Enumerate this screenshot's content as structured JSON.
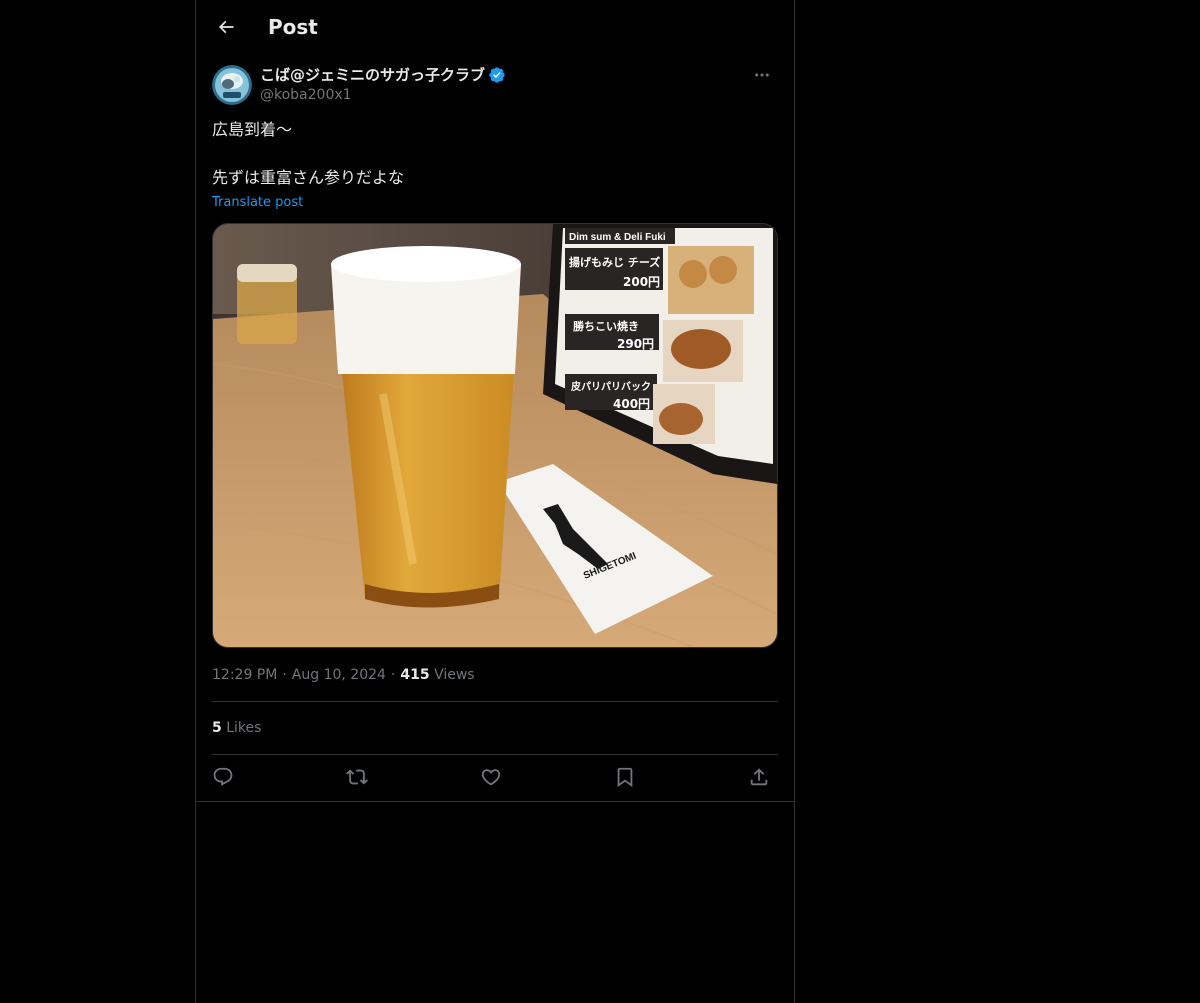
{
  "header": {
    "title": "Post",
    "back_icon": "arrow-left-icon"
  },
  "author": {
    "display_name": "こば@ジェミニのサガっ子クラブ",
    "handle": "@koba200x1",
    "verified_color": "#1d9bf0"
  },
  "post": {
    "line1": "広島到着〜",
    "line2": "先ずは重富さん参りだよな",
    "translate_label": "Translate post",
    "media_texts": {
      "menu_header": "Dim sum & Deli Fuki",
      "item1": "揚げもみじ チーズ",
      "item1_price": "200円",
      "item2": "勝ちこい焼き",
      "item2_price": "290円",
      "item3": "皮パリパリバック",
      "item3_price": "400円",
      "napkin_brand": "SHIGETOMI"
    }
  },
  "meta": {
    "time": "12:29 PM",
    "date": "Aug 10, 2024",
    "views_count": "415",
    "views_label": "Views",
    "separator": "·"
  },
  "engagement": {
    "likes_count": "5",
    "likes_label": "Likes"
  },
  "actions": [
    {
      "name": "reply",
      "icon": "reply-icon"
    },
    {
      "name": "repost",
      "icon": "repost-icon"
    },
    {
      "name": "like",
      "icon": "heart-icon"
    },
    {
      "name": "bookmark",
      "icon": "bookmark-icon"
    },
    {
      "name": "share",
      "icon": "share-icon"
    }
  ],
  "colors": {
    "background": "#000000",
    "text_primary": "#e7e9ea",
    "text_secondary": "#71767b",
    "link": "#1d9bf0",
    "border": "#2f3336"
  }
}
